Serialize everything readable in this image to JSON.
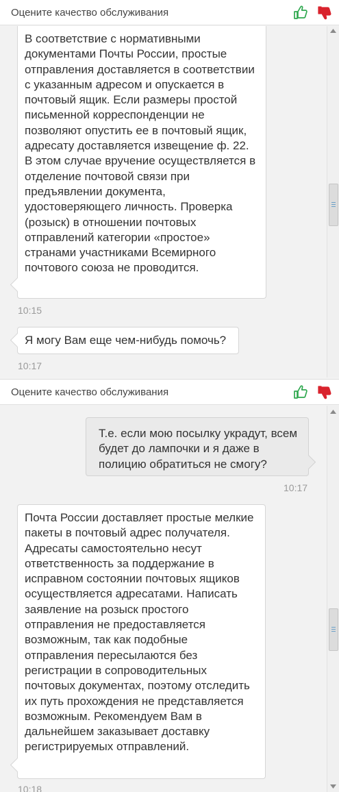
{
  "panels": [
    {
      "rating_title": "Оцените качество обслуживания",
      "like_icon": "thumbs-up-icon",
      "dislike_icon": "thumbs-down-icon",
      "messages": [
        {
          "direction": "incoming",
          "text": "В соответствие с нормативными документами Почты России, простые отправления доставляется в соответствии с указанным адресом и опускается в почтовый ящик. Если размеры простой письменной корреспонденции не позволяют опустить ее в почтовый ящик, адресату доставляется извещение ф. 22. В этом случае вручение осуществляется в отделение почтовой связи при предъявлении документа, удостоверяющего личность. Проверка (розыск) в отношении почтовых отправлений категории «простое» странами участниками Всемирного почтового союза не проводится.",
          "time": "10:15"
        },
        {
          "direction": "incoming",
          "text": "Я могу Вам еще чем-нибудь помочь?",
          "time": "10:17"
        }
      ]
    },
    {
      "rating_title": "Оцените качество обслуживания",
      "like_icon": "thumbs-up-icon",
      "dislike_icon": "thumbs-down-icon",
      "messages": [
        {
          "direction": "outgoing",
          "text": "Т.е. если мою посылку украдут, всем будет до лампочки и я даже в полицию обратиться не смогу?",
          "time": "10:17"
        },
        {
          "direction": "incoming",
          "text": "Почта России доставляет простые мелкие пакеты в почтовый адрес получателя. Адресаты самостоятельно несут ответственность за поддержание в исправном состоянии почтовых ящиков осуществляется адресатами. Написать заявление на розыск простого отправления не предоставляется возможным, так как подобные отправления пересылаются без регистрации в сопроводительных почтовых документах, поэтому отследить их путь прохождения не представляется возможным. Рекомендуем Вам в дальнейшем заказывает доставку регистрируемых отправлений.",
          "time": "10:18"
        }
      ]
    }
  ],
  "colors": {
    "like": "#2fa84f",
    "dislike": "#d9232d",
    "scroll_grip": "#6aa0c8"
  }
}
